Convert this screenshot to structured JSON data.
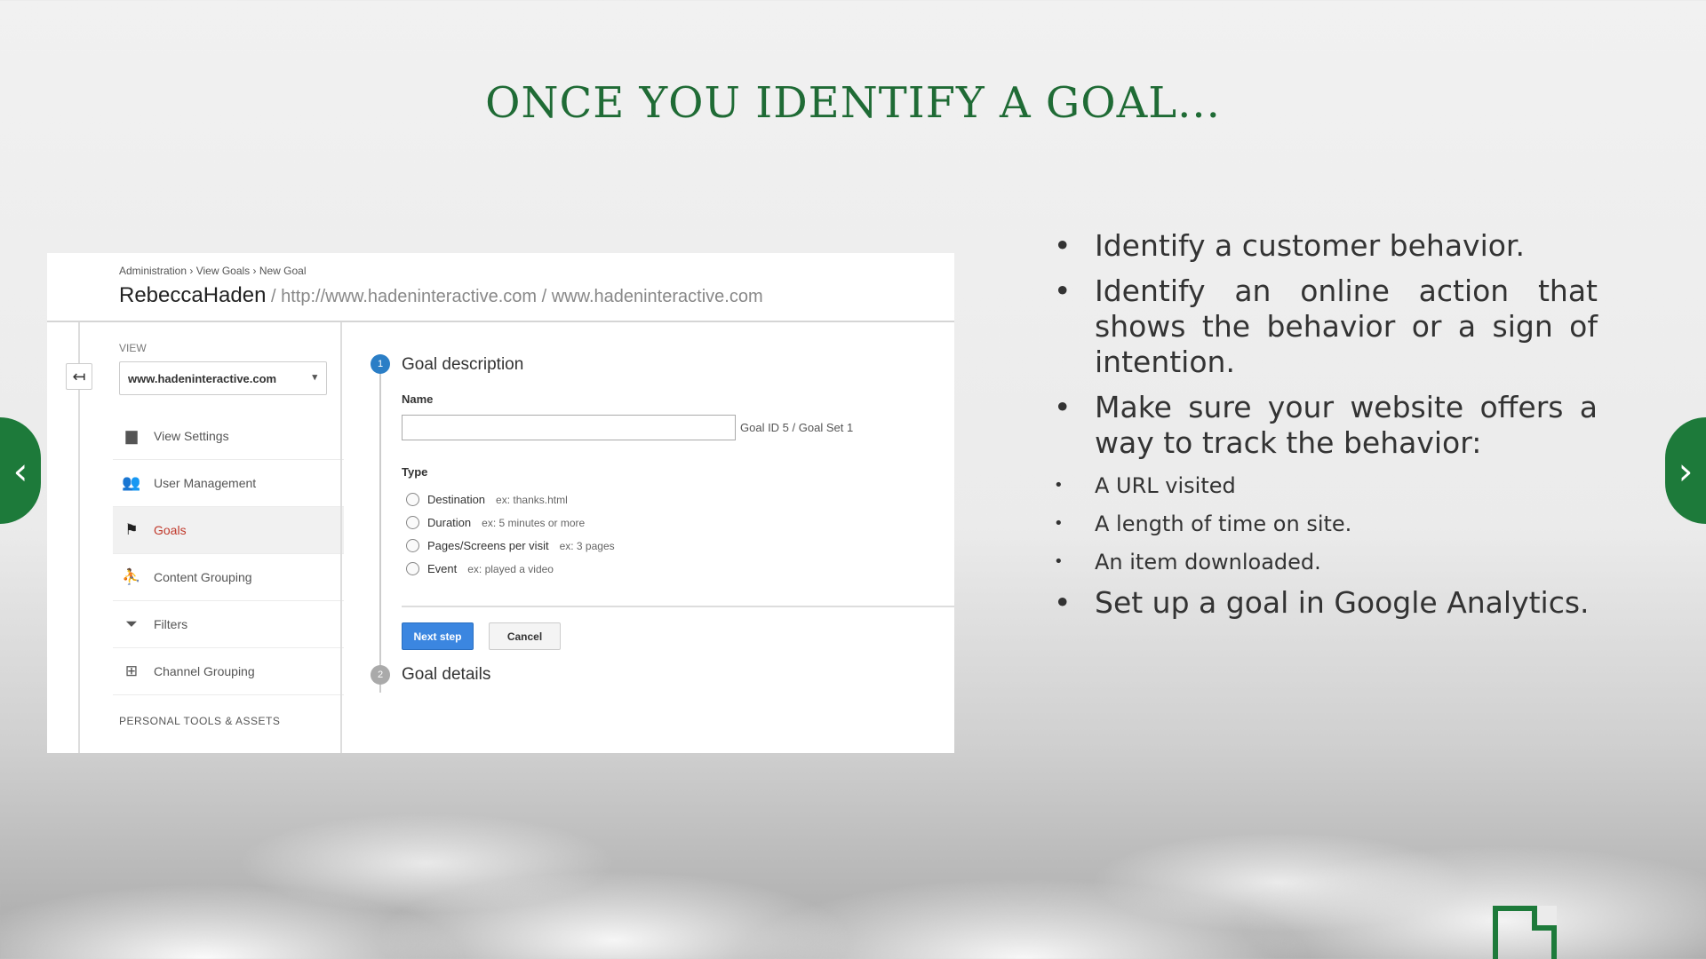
{
  "slide": {
    "title": "ONCE YOU IDENTIFY A GOAL..."
  },
  "nav": {
    "prev_icon": "chevron-left-icon",
    "next_icon": "chevron-right-icon",
    "prev_glyph": "‹",
    "next_glyph": "›"
  },
  "ga": {
    "breadcrumb": "Administration › View Goals › New Goal",
    "account": "RebeccaHaden",
    "property_path": " / http://www.hadeninteractive.com / www.hadeninteractive.com",
    "view_label": "VIEW",
    "view_selected": "www.hadeninteractive.com",
    "back_glyph": "↤",
    "sidebar": [
      {
        "label": "View Settings",
        "icon": "document-icon",
        "glyph": "▆"
      },
      {
        "label": "User Management",
        "icon": "users-icon",
        "glyph": "👥"
      },
      {
        "label": "Goals",
        "icon": "flag-icon",
        "glyph": "⚑"
      },
      {
        "label": "Content Grouping",
        "icon": "person-walk-icon",
        "glyph": "⛹"
      },
      {
        "label": "Filters",
        "icon": "filter-icon",
        "glyph": "⏷"
      },
      {
        "label": "Channel Grouping",
        "icon": "channel-icon",
        "glyph": "⊞"
      }
    ],
    "personal": "PERSONAL TOOLS & ASSETS",
    "step1_num": "1",
    "step1_title": "Goal description",
    "name_label": "Name",
    "name_value": "",
    "goal_id": "Goal ID 5 / Goal Set 1",
    "type_label": "Type",
    "types": [
      {
        "label": "Destination",
        "example": "ex: thanks.html"
      },
      {
        "label": "Duration",
        "example": "ex: 5 minutes or more"
      },
      {
        "label": "Pages/Screens per visit",
        "example": "ex: 3 pages"
      },
      {
        "label": "Event",
        "example": "ex: played a video"
      }
    ],
    "next_label": "Next step",
    "cancel_label": "Cancel",
    "step2_num": "2",
    "step2_title": "Goal details"
  },
  "bullets": [
    {
      "text": "Identify a customer behavior.",
      "level": "big"
    },
    {
      "text": "Identify an online action that shows the behavior or a sign of intention.",
      "level": "big"
    },
    {
      "text": "Make sure your website offers a way to track the behavior:",
      "level": "big"
    },
    {
      "text": "A URL visited",
      "level": "small"
    },
    {
      "text": "A length of time on site.",
      "level": "small"
    },
    {
      "text": "An item downloaded.",
      "level": "small"
    },
    {
      "text": "Set up a goal in Google Analytics.",
      "level": "big"
    }
  ],
  "colors": {
    "title_green": "#1f6b35",
    "nav_green": "#1d7a3a",
    "ga_blue": "#3b86e0",
    "goals_active": "#c0392b"
  }
}
